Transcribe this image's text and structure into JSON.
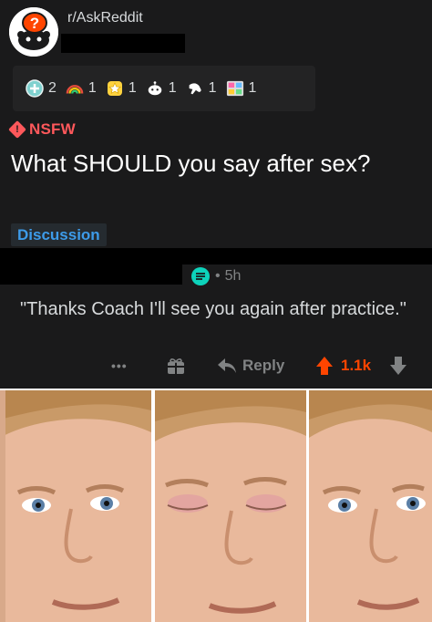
{
  "post": {
    "subreddit": "r/AskReddit",
    "awards": [
      {
        "icon": "helpful-award-icon",
        "count": "2"
      },
      {
        "icon": "rainbow-award-icon",
        "count": "1"
      },
      {
        "icon": "star-award-icon",
        "count": "1"
      },
      {
        "icon": "snoo-award-icon",
        "count": "1"
      },
      {
        "icon": "thumbs-award-icon",
        "count": "1"
      },
      {
        "icon": "grid-award-icon",
        "count": "1"
      }
    ],
    "nsfw_label": "NSFW",
    "title": "What SHOULD you say after sex?",
    "flair": "Discussion"
  },
  "comment": {
    "age": "5h",
    "body": "\"Thanks Coach I'll see you again after practice.\"",
    "more_label": "•••",
    "reply_label": "Reply",
    "score": "1.1k"
  },
  "meme": {
    "panels": [
      "blinking-guy-open",
      "blinking-guy-closed",
      "blinking-guy-open-2"
    ]
  },
  "colors": {
    "background": "#1a1a1b",
    "nsfw": "#ff585b",
    "flair_text": "#3d9be9",
    "upvote": "#ff4500",
    "muted": "#818384"
  }
}
